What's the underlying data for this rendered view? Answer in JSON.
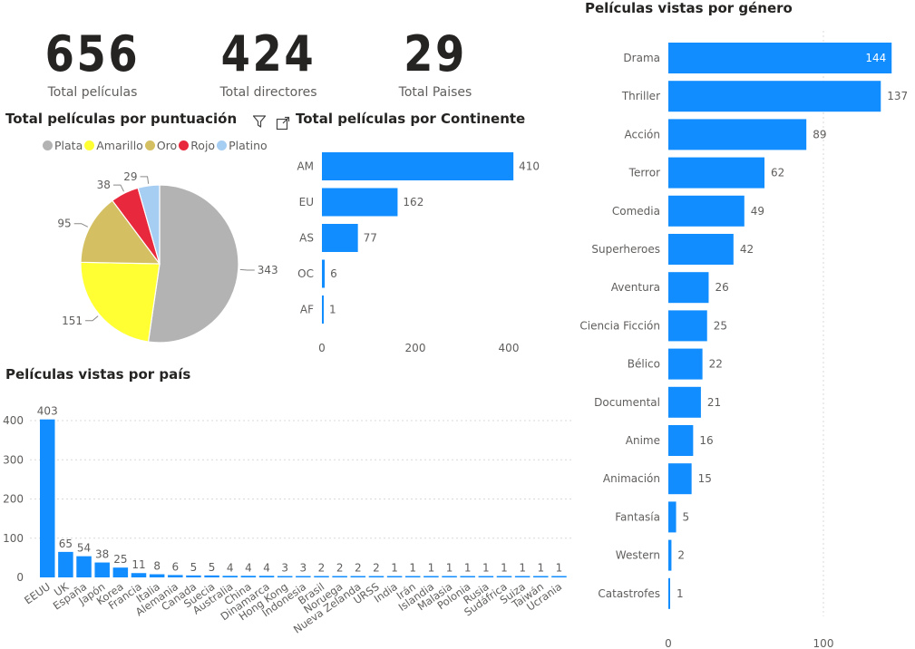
{
  "kpis": {
    "total_peliculas": {
      "value": "656",
      "label": "Total películas"
    },
    "total_directores": {
      "value": "424",
      "label": "Total directores"
    },
    "total_paises": {
      "value": "29",
      "label": "Total Paises"
    }
  },
  "toolbar": {
    "filter_icon": "filter-icon",
    "focus_icon": "focus-mode-icon"
  },
  "chart_data": [
    {
      "id": "puntuacion",
      "type": "pie",
      "title": "Total películas por puntuación",
      "legend_position": "top",
      "categories": [
        "Plata",
        "Amarillo",
        "Oro",
        "Rojo",
        "Platino"
      ],
      "values": [
        343,
        151,
        95,
        38,
        29
      ],
      "colors": [
        "#b3b3b3",
        "#ffff33",
        "#d4c062",
        "#e8283c",
        "#a6cdf2"
      ]
    },
    {
      "id": "continente",
      "type": "bar",
      "orientation": "horizontal",
      "title": "Total películas por Continente",
      "categories": [
        "AM",
        "EU",
        "AS",
        "OC",
        "AF"
      ],
      "values": [
        410,
        162,
        77,
        6,
        1
      ],
      "xticks": [
        0,
        200,
        400
      ],
      "color": "#118dff"
    },
    {
      "id": "pais",
      "type": "bar",
      "orientation": "vertical",
      "title": "Películas vistas por país",
      "categories": [
        "EEUU",
        "UK",
        "España",
        "Japón",
        "Korea",
        "Francia",
        "Italia",
        "Alemania",
        "Canada",
        "Suecia",
        "Australia",
        "China",
        "Dinamarca",
        "Hong Kong",
        "Indonesia",
        "Brasil",
        "Noruega",
        "Nueva Zelanda",
        "URSS",
        "India",
        "Irán",
        "Islandia",
        "Malasia",
        "Polonia",
        "Rusia",
        "Sudáfrica",
        "Suiza",
        "Taiwán",
        "Ucrania"
      ],
      "values": [
        403,
        65,
        54,
        38,
        25,
        11,
        8,
        6,
        5,
        5,
        4,
        4,
        4,
        3,
        3,
        2,
        2,
        2,
        2,
        1,
        1,
        1,
        1,
        1,
        1,
        1,
        1,
        1,
        1
      ],
      "yticks": [
        0,
        100,
        200,
        300,
        400
      ],
      "grid": true,
      "color": "#118dff"
    },
    {
      "id": "genero",
      "type": "bar",
      "orientation": "horizontal",
      "title": "Películas vistas por género",
      "categories": [
        "Drama",
        "Thriller",
        "Acción",
        "Terror",
        "Comedia",
        "Superheroes",
        "Aventura",
        "Ciencia Ficción",
        "Bélico",
        "Documental",
        "Anime",
        "Animación",
        "Fantasía",
        "Western",
        "Catastrofes"
      ],
      "values": [
        144,
        137,
        89,
        62,
        49,
        42,
        26,
        25,
        22,
        21,
        16,
        15,
        5,
        2,
        1
      ],
      "xticks": [
        0,
        100
      ],
      "grid": true,
      "color": "#118dff"
    }
  ]
}
